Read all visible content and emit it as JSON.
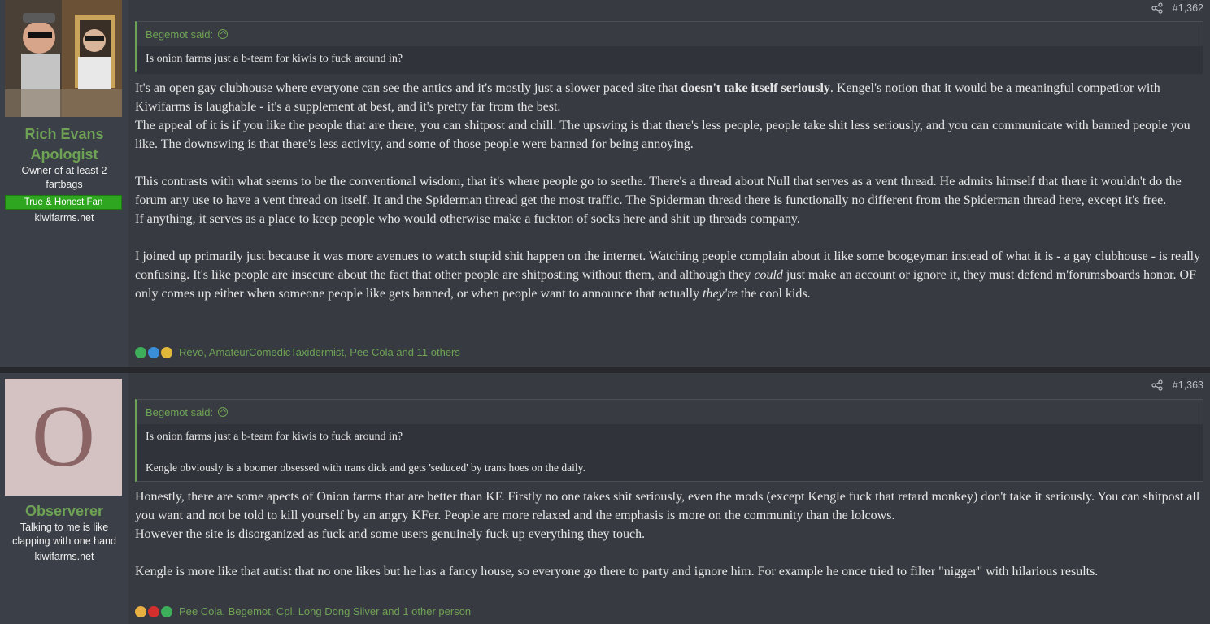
{
  "posts": [
    {
      "username_line1": "Rich Evans",
      "username_line2": "Apologist",
      "user_title_line1": "Owner of at least 2",
      "user_title_line2": "fartbags",
      "banner": "True & Honest Fan",
      "site": "kiwifarms.net",
      "post_number": "#1,362",
      "quote": {
        "author": "Begemot said:",
        "lines": [
          "Is onion farms just a b-team for kiwis to fuck around in?"
        ]
      },
      "body": {
        "p1_a": "It's an open gay clubhouse where everyone can see the antics and it's mostly just a slower paced site that ",
        "p1_bold": "doesn't take itself seriously",
        "p1_b": ". Kengel's notion that it would be a meaningful competitor with Kiwifarms is laughable - it's a supplement at best, and it's pretty far from the best.",
        "p2": "The appeal of it is if you like the people that are there, you can shitpost and chill. The upswing is that there's less people, people take shit less seriously, and you can communicate with banned people you like. The downswing is that there's less activity, and some of those people were banned for being annoying.",
        "p3": "This contrasts with what seems to be the conventional wisdom, that it's where people go to seethe. There's a thread about Null that serves as a vent thread. He admits himself that there it wouldn't do the forum any use to have a vent thread on itself. It and the Spiderman thread get the most traffic. The Spiderman thread there is functionally no different from the Spiderman thread here, except it's free.",
        "p4": "If anything, it serves as a place to keep people who would otherwise make a fuckton of socks here and shit up threads company.",
        "p5_a": "I joined up primarily just because it was more avenues to watch stupid shit happen on the internet. Watching people complain about it like some boogeyman instead of what it is - a gay clubhouse - is really confusing. It's like people are insecure about the fact that other people are shitposting without them, and although they ",
        "p5_it1": "could",
        "p5_b": " just make an account or ignore it, they must defend m'forumsboards honor. OF only comes up either when someone people like gets banned, or when people want to announce that actually ",
        "p5_it2": "they're",
        "p5_c": " the cool kids."
      },
      "reactions": "Revo, AmateurComedicTaxidermist, Pee Cola and 11 others"
    },
    {
      "avatar_letter": "O",
      "username": "Observerer",
      "user_title_line1": "Talking to me is like",
      "user_title_line2": "clapping with one hand",
      "site": "kiwifarms.net",
      "post_number": "#1,363",
      "quote": {
        "author": "Begemot said:",
        "lines": [
          "Is onion farms just a b-team for kiwis to fuck around in?",
          "Kengle obviously is a boomer obsessed with trans dick and gets 'seduced' by trans hoes on the daily."
        ]
      },
      "body": {
        "p1": "Honestly, there are some apects of Onion farms that are better than KF. Firstly no one takes shit seriously, even the mods (except Kengle fuck that retard monkey) don't take it seriously. You can shitpost all you want and not be told to kill yourself by an angry KFer. People are more relaxed and the emphasis is more on the community than the lolcows.",
        "p2": "However the site is disorganized as fuck and some users genuinely fuck up everything they touch.",
        "p3": "Kengle is more like that autist that no one likes but he has a fancy house, so everyone go there to party and ignore him. For example he once tried to filter \"nigger\" with hilarious results."
      },
      "reactions": "Pee Cola, Begemot, Cpl. Long Dong Silver and 1 other person"
    }
  ],
  "colors": {
    "accent": "#6ea254",
    "banner": "#2ea620",
    "page_bg": "#2d3035",
    "post_bg": "#373b41",
    "user_bg": "#3b3f47"
  },
  "icons": [
    "share-icon",
    "up-arrow-icon",
    "check-reaction-icon",
    "thumbs-up-reaction-icon",
    "medal-reaction-icon",
    "thinking-reaction-icon",
    "heart-reaction-icon"
  ]
}
